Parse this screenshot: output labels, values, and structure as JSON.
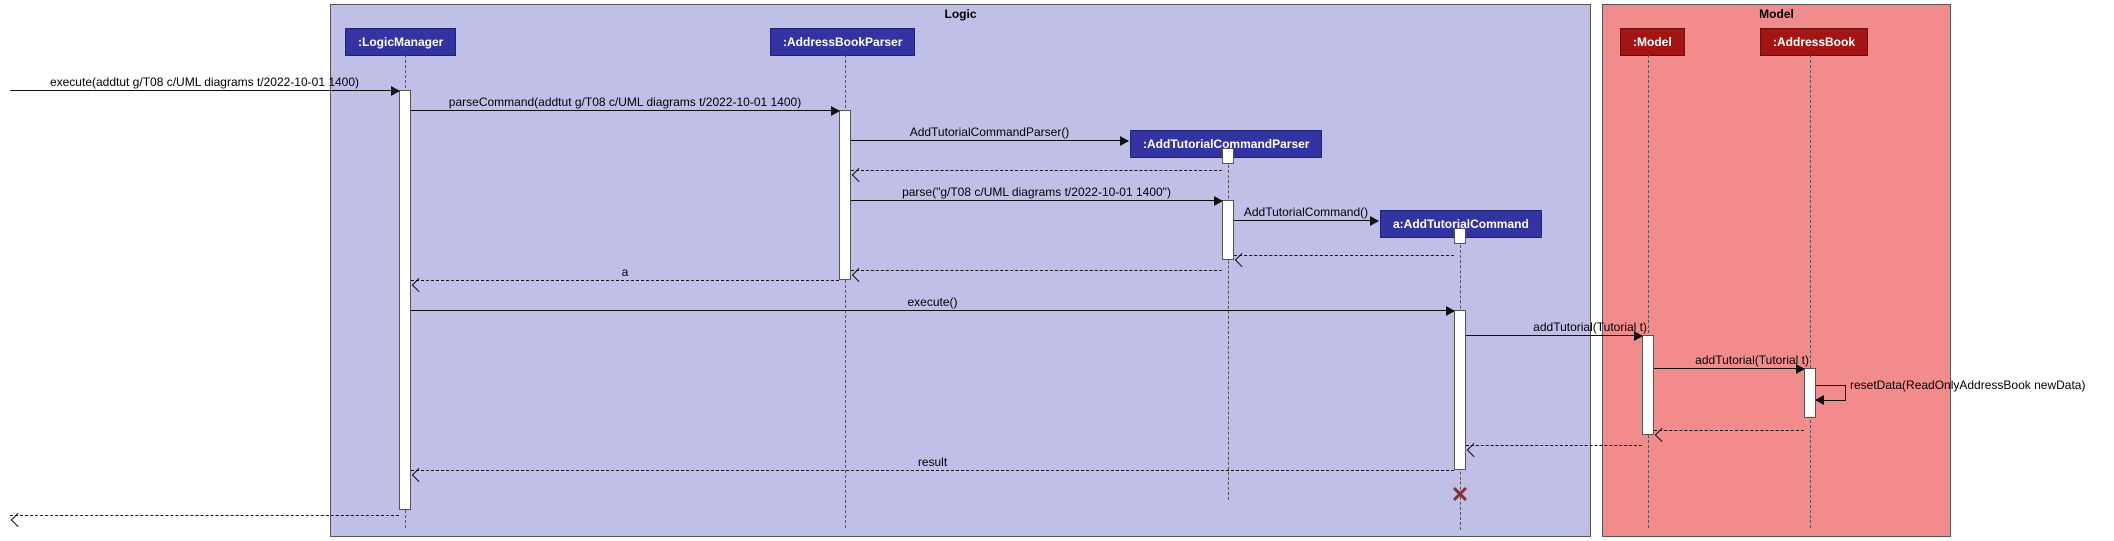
{
  "frames": {
    "logic": "Logic",
    "model": "Model"
  },
  "participants": {
    "logicManager": ":LogicManager",
    "parser": ":AddressBookParser",
    "addParser": ":AddTutorialCommandParser",
    "addCommand": "a:AddTutorialCommand",
    "model": ":Model",
    "addressBook": ":AddressBook"
  },
  "messages": {
    "m1": "execute(addtut g/T08 c/UML diagrams t/2022-10-01 1400)",
    "m2": "parseCommand(addtut g/T08 c/UML diagrams t/2022-10-01 1400)",
    "m3": "AddTutorialCommandParser()",
    "m4": "parse(\"g/T08 c/UML diagrams t/2022-10-01 1400\")",
    "m5": "AddTutorialCommand()",
    "m6": "a",
    "m7": "execute()",
    "m8": "addTutorial(Tutorial t)",
    "m9": "addTutorial(Tutorial t)",
    "m10": "resetData(ReadOnlyAddressBook newData)",
    "m11": "result"
  }
}
